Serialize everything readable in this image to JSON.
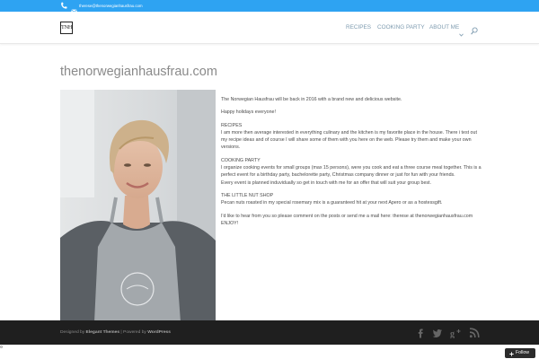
{
  "topbar": {
    "email": "therese@thenorwegianhausfrau.com",
    "phone_icon": "phone-icon",
    "mail_icon": "mail-icon",
    "bg_color": "#2ea3f2"
  },
  "header": {
    "logo_text": "TNH",
    "nav": [
      {
        "label": "RECIPES"
      },
      {
        "label": "COOKING PARTY"
      },
      {
        "label": "ABOUT ME"
      }
    ],
    "nav_color": "#7f9cb0",
    "icons": [
      "chevron-down-icon",
      "search-icon"
    ]
  },
  "page": {
    "title": "thenorwegianhausfrau.com",
    "intro": "The Norwegian Hausfrau will be back in 2016 with a brand new and delicious website.",
    "greeting": "Happy holidays everyone!",
    "sections": [
      {
        "heading": "RECIPES",
        "body": "I am more then average interested in everything culinary and the kitchen is my favorite place in the house. There i test out my recipe ideas and of course I will share some of them with you here on the web. Please try them and make your own versions."
      },
      {
        "heading": "COOKING PARTY",
        "body": "I organize cooking events for small groups (max 15 persons), were you cook and eat a three course meal together. This is a perfect event for a birthday party, bachelorette party, Christmas company dinner or just for fun with your friends.",
        "body2": "Every event is planned induvidually so get in touch with me for an offer that will suit your group best."
      },
      {
        "heading": "THE LITTLE NUT SHOP",
        "body": "Pecan nuts roasted in my special rosemary mix is a guaranteed hit at your next Apero or as a hostessgift."
      }
    ],
    "contact": "I'd like to hear from you so please comment on the posts or send me a mail here: therese at thenorwegianhausfrau.com",
    "closing": "ENJOY!"
  },
  "footer": {
    "designed_by": "Designed by",
    "elegant": "Elegant Themes",
    "powered_by": "| Powered by",
    "wordpress": "WordPress",
    "social": [
      "facebook-icon",
      "twitter-icon",
      "google-plus-icon",
      "rss-icon"
    ]
  },
  "follow": {
    "label": "Follow"
  }
}
